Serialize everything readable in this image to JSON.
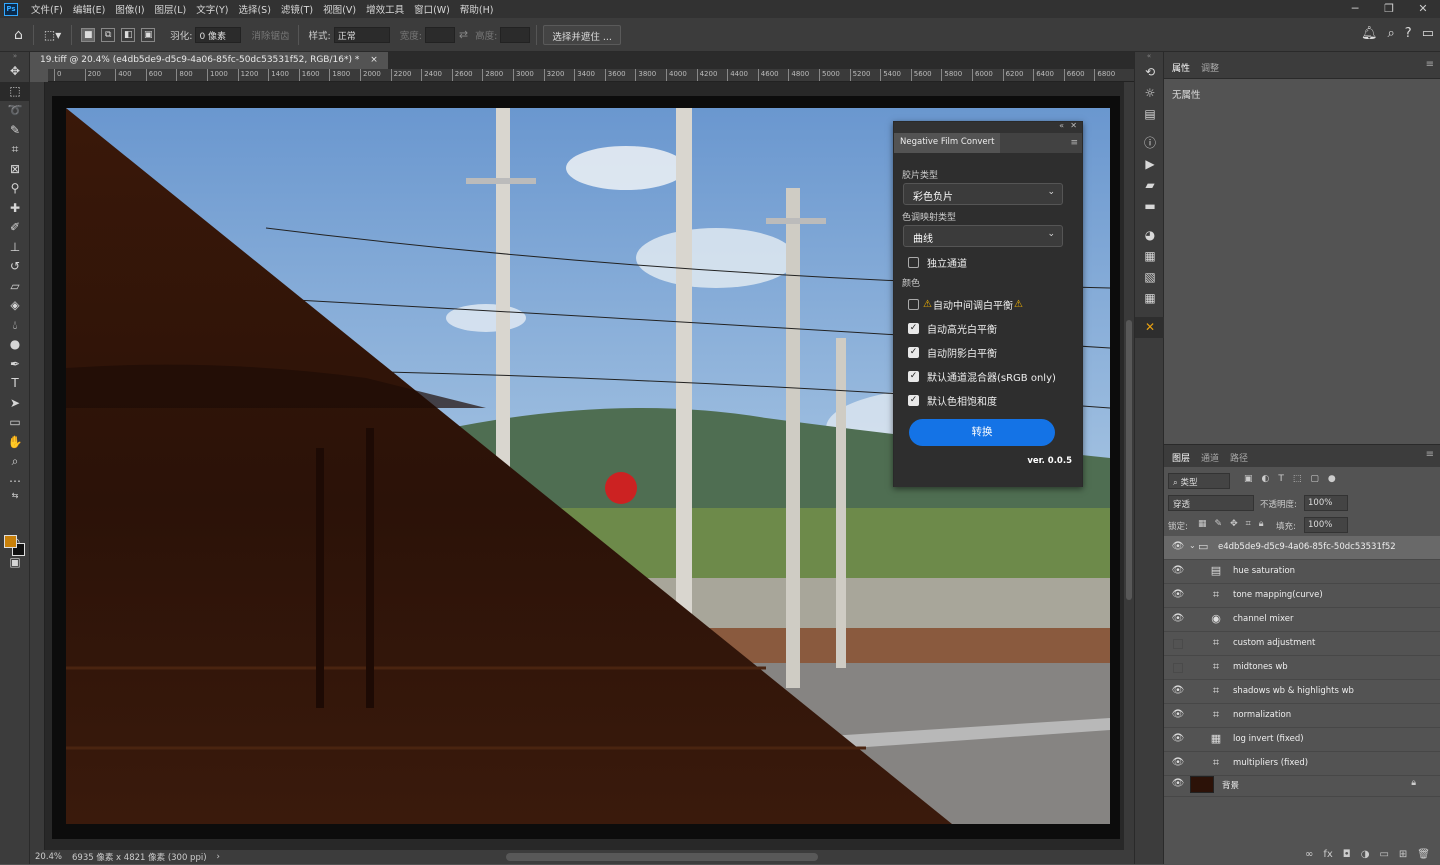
{
  "menubar": {
    "logo": "Ps",
    "items": [
      "文件(F)",
      "编辑(E)",
      "图像(I)",
      "图层(L)",
      "文字(Y)",
      "选择(S)",
      "滤镜(T)",
      "视图(V)",
      "增效工具",
      "窗口(W)",
      "帮助(H)"
    ],
    "window_controls": [
      "─",
      "❐",
      "✕"
    ]
  },
  "options": {
    "feather_label": "羽化:",
    "feather_value": "0 像素",
    "antialias_label": "消除锯齿",
    "style_label": "样式:",
    "style_value": "正常",
    "width_label": "宽度:",
    "height_label": "高度:",
    "select_mask_button": "选择并遮住 ..."
  },
  "document": {
    "tab_title": "19.tiff @ 20.4% (e4db5de9-d5c9-4a06-85fc-50dc53531f52, RGB/16*) *",
    "close_glyph": "×"
  },
  "ruler": {
    "top_ticks": [
      "0",
      "200",
      "400",
      "600",
      "800",
      "1000",
      "1200",
      "1400",
      "1600",
      "1800",
      "2000",
      "2200",
      "2400",
      "2600",
      "2800",
      "3000",
      "3200",
      "3400",
      "3600",
      "3800",
      "4000",
      "4200",
      "4400",
      "4600",
      "4800",
      "5000",
      "5200",
      "5400",
      "5600",
      "5800",
      "6000",
      "6200",
      "6400",
      "6600",
      "6800"
    ]
  },
  "status": {
    "zoom": "20.4%",
    "doc_info": "6935 像素 x 4821 像素 (300 ppi)",
    "arrow": "›"
  },
  "plugin": {
    "title": "Negative Film Convert",
    "film_type_label": "胶片类型",
    "film_type_value": "彩色负片",
    "tone_mapping_label": "色调映射类型",
    "tone_mapping_value": "曲线",
    "independent_channel": "独立通道",
    "color_section": "颜色",
    "options": [
      {
        "label": "自动中间调白平衡",
        "checked": false,
        "warning": true
      },
      {
        "label": "自动高光白平衡",
        "checked": true,
        "warning": false
      },
      {
        "label": "自动阴影白平衡",
        "checked": true,
        "warning": false
      },
      {
        "label": "默认通道混合器(sRGB only)",
        "checked": true,
        "warning": false
      },
      {
        "label": "默认色相饱和度",
        "checked": true,
        "warning": false
      }
    ],
    "convert_button": "转换",
    "version": "ver. 0.0.5"
  },
  "properties": {
    "tab_active": "属性",
    "tab_other": "调整",
    "empty_text": "无属性"
  },
  "layers": {
    "tabs": [
      "图层",
      "通道",
      "路径"
    ],
    "filter_kind": "类型",
    "blend_mode": "穿透",
    "opacity_label": "不透明度:",
    "opacity_value": "100%",
    "lock_label": "锁定:",
    "fill_label": "填充:",
    "fill_value": "100%",
    "group_name": "e4db5de9-d5c9-4a06-85fc-50dc53531f52",
    "items": [
      {
        "name": "hue saturation",
        "visible": true,
        "icon": "hue-saturation-icon"
      },
      {
        "name": "tone mapping(curve)",
        "visible": true,
        "icon": "curves-icon"
      },
      {
        "name": "channel mixer",
        "visible": true,
        "icon": "channel-mixer-icon"
      },
      {
        "name": "custom adjustment",
        "visible": false,
        "icon": "curves-icon"
      },
      {
        "name": "midtones wb",
        "visible": false,
        "icon": "curves-icon"
      },
      {
        "name": "shadows wb & highlights wb",
        "visible": true,
        "icon": "curves-icon"
      },
      {
        "name": "normalization",
        "visible": true,
        "icon": "curves-icon"
      },
      {
        "name": "log invert (fixed)",
        "visible": true,
        "icon": "levels-icon"
      },
      {
        "name": "multipliers (fixed)",
        "visible": true,
        "icon": "curves-icon"
      }
    ],
    "background_name": "背景"
  },
  "colors": {
    "foreground": "#c8800a",
    "background": "#111111",
    "accent": "#1473e6",
    "negative_base": "#2c1208"
  }
}
